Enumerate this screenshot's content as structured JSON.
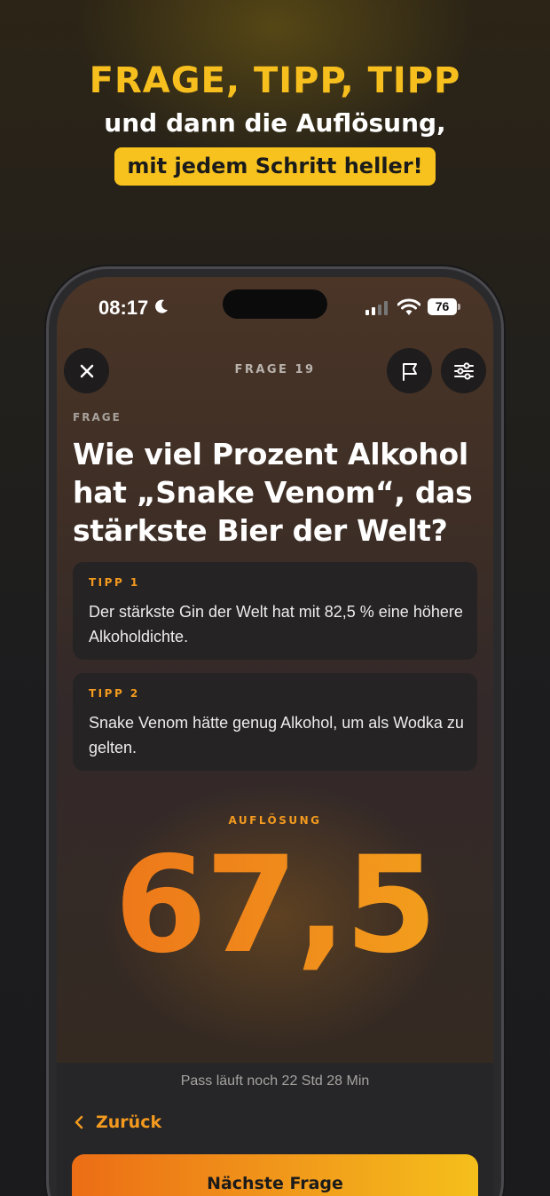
{
  "promo": {
    "title": "FRAGE, TIPP, TIPP",
    "subtitle": "und dann die Auflösung,",
    "pill": "mit jedem Schritt heller!"
  },
  "status_bar": {
    "time": "08:17",
    "battery": "76"
  },
  "nav": {
    "title": "FRAGE 19"
  },
  "question": {
    "label": "FRAGE",
    "text": "Wie viel Prozent Alkohol hat „Snake Venom“, das stärkste Bier der Welt?"
  },
  "tips": [
    {
      "label": "TIPP 1",
      "text": "Der stärkste Gin der Welt hat mit 82,5 % eine höhere Alkoholdichte."
    },
    {
      "label": "TIPP 2",
      "text": "Snake Venom hätte genug Alkohol, um als Wodka zu gelten."
    }
  ],
  "answer": {
    "label": "AUFLÖSUNG",
    "value": "67,5"
  },
  "footer": {
    "pass_text": "Pass läuft noch 22 Std 28 Min",
    "back_label": "Zurück",
    "next_label": "Nächste Frage"
  },
  "colors": {
    "accent": "#f39a1f",
    "promo_yellow": "#f7c21e"
  }
}
